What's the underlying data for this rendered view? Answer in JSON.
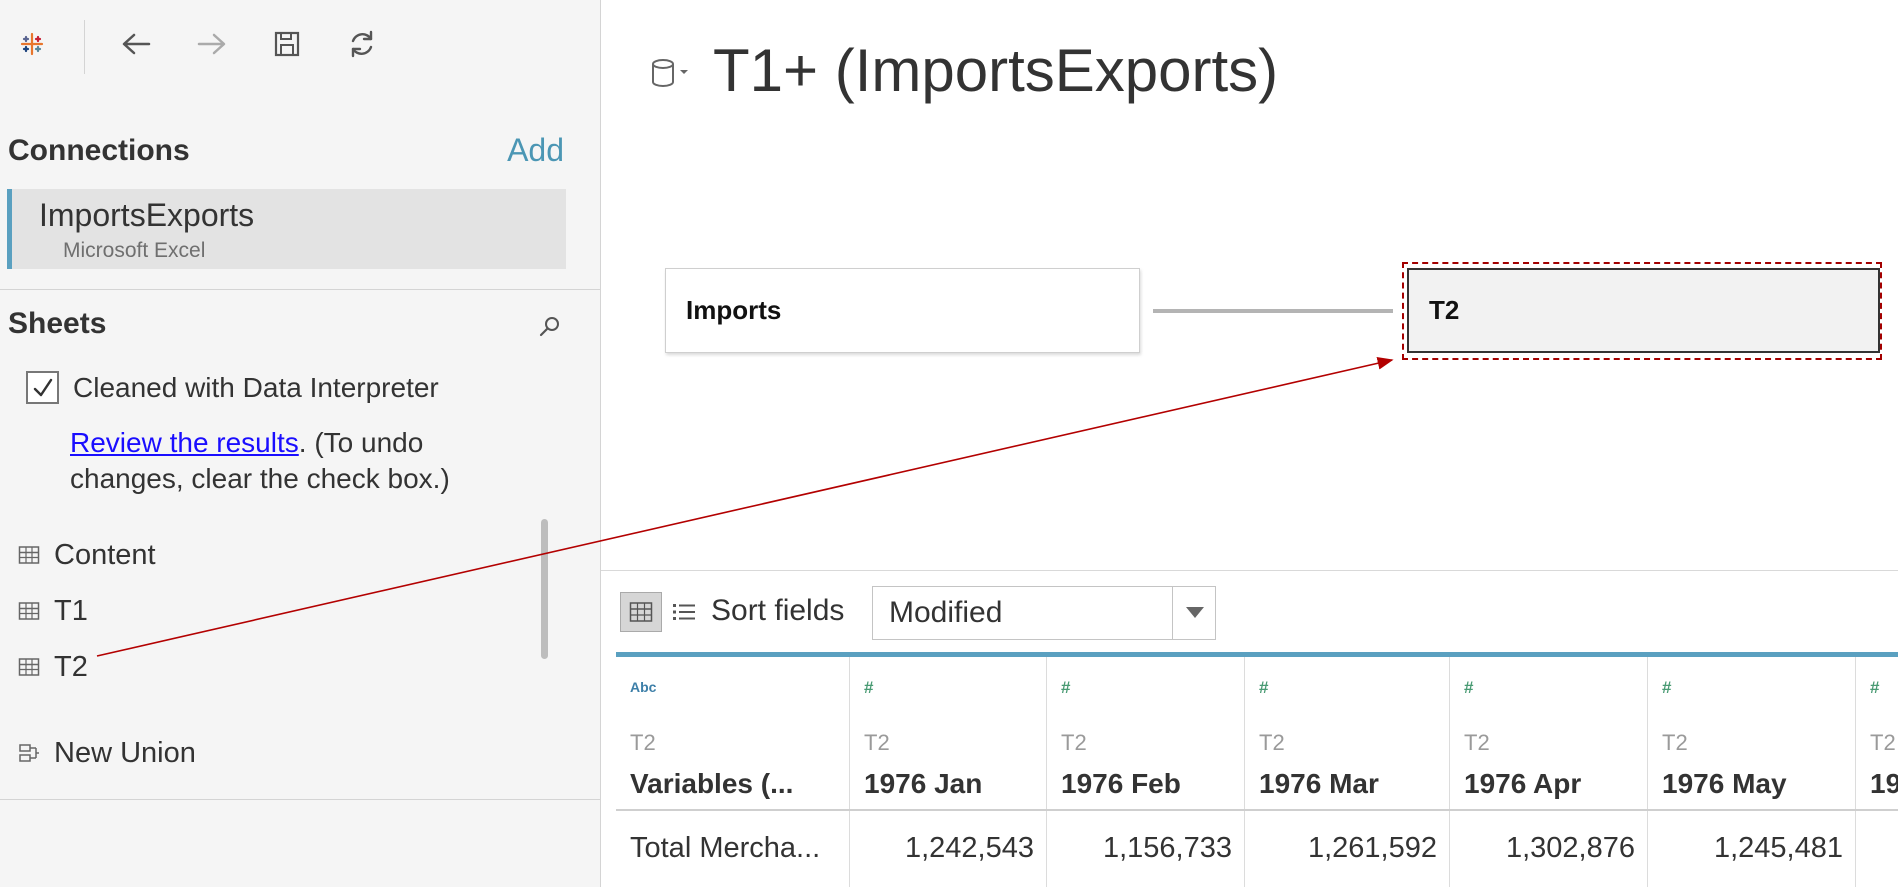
{
  "toolbar": {
    "logo_icon": "tableau-logo-icon",
    "back_icon": "back-arrow-icon",
    "forward_icon": "forward-arrow-icon",
    "save_icon": "save-icon",
    "refresh_icon": "refresh-icon"
  },
  "connections": {
    "header": "Connections",
    "add_label": "Add",
    "items": [
      {
        "name": "ImportsExports",
        "type": "Microsoft Excel"
      }
    ]
  },
  "sheets": {
    "header": "Sheets",
    "interpreter_label": "Cleaned with Data Interpreter",
    "interpreter_checked": true,
    "review_link": "Review the results",
    "review_rest": ". (To undo changes, clear the check box.)",
    "items": [
      {
        "label": "Content",
        "icon": "table-icon"
      },
      {
        "label": "T1",
        "icon": "table-icon"
      },
      {
        "label": "T2",
        "icon": "table-icon"
      },
      {
        "label": "New Union",
        "icon": "union-icon"
      }
    ]
  },
  "datasource": {
    "title": "T1+ (ImportsExports)",
    "tables": [
      "Imports",
      "T2"
    ]
  },
  "grid_controls": {
    "sort_label": "Sort fields",
    "sort_value": "Modified"
  },
  "grid": {
    "columns": [
      {
        "type": "Abc",
        "source": "T2",
        "name": "Variables (..."
      },
      {
        "type": "#",
        "source": "T2",
        "name": "1976 Jan"
      },
      {
        "type": "#",
        "source": "T2",
        "name": "1976 Feb"
      },
      {
        "type": "#",
        "source": "T2",
        "name": "1976 Mar"
      },
      {
        "type": "#",
        "source": "T2",
        "name": "1976 Apr"
      },
      {
        "type": "#",
        "source": "T2",
        "name": "1976 May"
      },
      {
        "type": "#",
        "source": "T2",
        "name": "19"
      }
    ],
    "rows": [
      [
        "Total Mercha...",
        "1,242,543",
        "1,156,733",
        "1,261,592",
        "1,302,876",
        "1,245,481",
        ""
      ]
    ]
  },
  "colors": {
    "accent": "#5aa0c0",
    "link": "#1a0dff",
    "annotation": "#b30000"
  }
}
